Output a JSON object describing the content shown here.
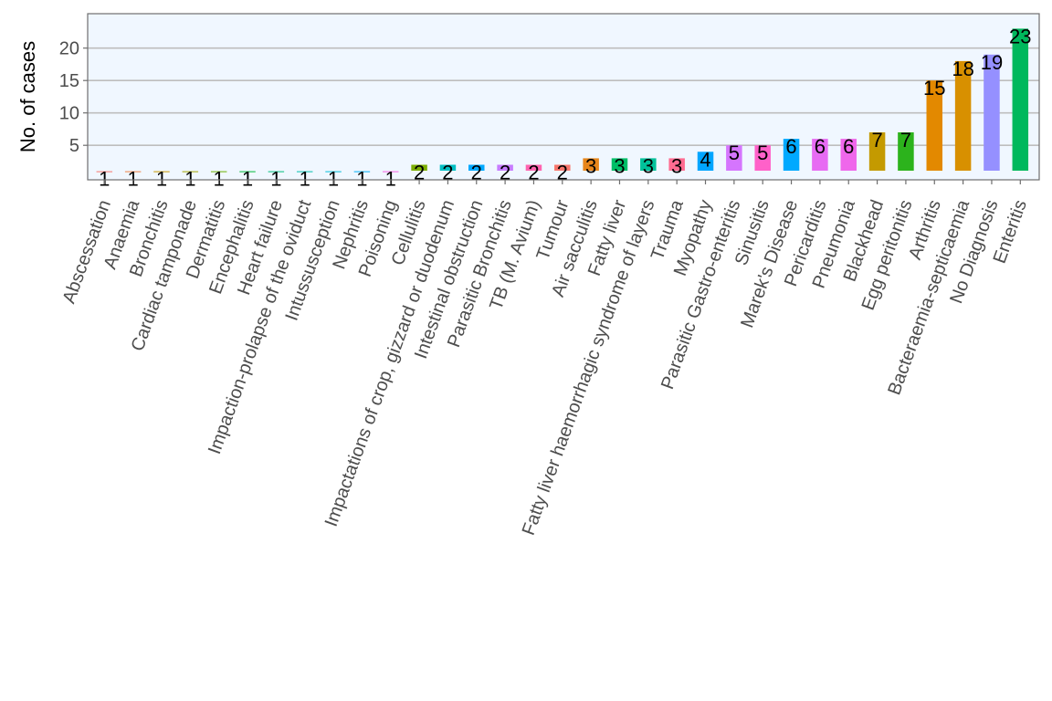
{
  "chart_data": {
    "type": "bar",
    "title": "",
    "xlabel": "",
    "ylabel": "No. of cases",
    "ylim": [
      0,
      25
    ],
    "yticks": [
      5,
      10,
      15,
      20
    ],
    "grid": true,
    "legend": "none",
    "background_color": "#f0f7ff",
    "grid_color": "#bebebe",
    "categories": [
      "Abscessation",
      "Anaemia",
      "Bronchitis",
      "Cardiac tamponade",
      "Dermatitis",
      "Encephalitis",
      "Heart failure",
      "Impaction-prolapse of the oviduct",
      "Intussusception",
      "Nephritis",
      "Poisoning",
      "Cellulitis",
      "Impactations of crop, gizzard or duodenum",
      "Intestinal obstruction",
      "Parasitic Bronchitis",
      "TB (M. Avium)",
      "Tumour",
      "Air sacculitis",
      "Fatty liver",
      "Fatty liver haemorrhagic syndrome of layers",
      "Trauma",
      "Myopathy",
      "Parasitic Gastro-enteritis",
      "Sinusitis",
      "Marek's Disease",
      "Pericarditis",
      "Pneumonia",
      "Blackhead",
      "Egg peritonitis",
      "Arthritis",
      "Bacteraemia-septicaemia",
      "No Diagnosis",
      "Enteritis"
    ],
    "values": [
      1,
      1,
      1,
      1,
      1,
      1,
      1,
      1,
      1,
      1,
      1,
      2,
      2,
      2,
      2,
      2,
      2,
      3,
      3,
      3,
      3,
      4,
      5,
      5,
      6,
      6,
      6,
      7,
      7,
      15,
      18,
      19,
      23
    ],
    "value_labels": [
      "1",
      "1",
      "1",
      "1",
      "1",
      "1",
      "1",
      "1",
      "1",
      "1",
      "1",
      "2",
      "2",
      "2",
      "2",
      "2",
      "2",
      "3",
      "3",
      "3",
      "3",
      "4",
      "5",
      "5",
      "6",
      "6",
      "6",
      "7",
      "7",
      "15",
      "18",
      "19",
      "23"
    ],
    "colors": [
      "#f8766d",
      "#ee8044",
      "#c99800",
      "#a3a500",
      "#6bb100",
      "#00ba38",
      "#00bf7d",
      "#00c0af",
      "#00bcd8",
      "#00b0f6",
      "#f564e3",
      "#7cae00",
      "#00bfc4",
      "#00a9ff",
      "#c77cff",
      "#ff64b0",
      "#f8766d",
      "#e7861b",
      "#00be67",
      "#00c19a",
      "#ff6c91",
      "#00a5ff",
      "#d575fe",
      "#ff61c9",
      "#00a9ff",
      "#e76bf3",
      "#ef67eb",
      "#c49a00",
      "#2cb31c",
      "#e38900",
      "#d89000",
      "#9590ff",
      "#00b85c"
    ]
  }
}
